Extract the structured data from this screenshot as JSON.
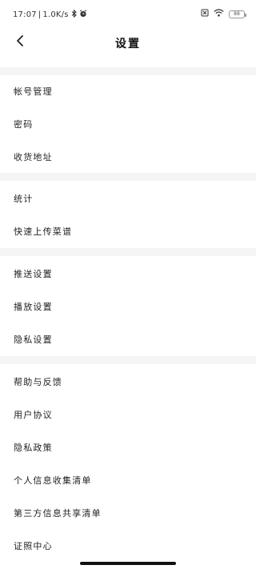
{
  "status_bar": {
    "time": "17:07",
    "speed": "1.0K/s",
    "battery_level": "88",
    "icons": [
      "bluetooth-icon",
      "alarm-icon",
      "sim-icon",
      "wifi-icon",
      "battery-icon"
    ]
  },
  "nav": {
    "title": "设置",
    "back_icon": "chevron-left-icon"
  },
  "groups": [
    {
      "items": [
        {
          "label": "帐号管理"
        },
        {
          "label": "密码"
        },
        {
          "label": "收货地址"
        }
      ]
    },
    {
      "items": [
        {
          "label": "统计"
        },
        {
          "label": "快速上传菜谱"
        }
      ]
    },
    {
      "items": [
        {
          "label": "推送设置"
        },
        {
          "label": "播放设置"
        },
        {
          "label": "隐私设置"
        }
      ]
    },
    {
      "items": [
        {
          "label": "帮助与反馈"
        },
        {
          "label": "用户协议"
        },
        {
          "label": "隐私政策"
        },
        {
          "label": "个人信息收集清单"
        },
        {
          "label": "第三方信息共享清单"
        },
        {
          "label": "证照中心"
        }
      ]
    }
  ],
  "colors": {
    "background": "#ffffff",
    "group_separator": "#f5f5f5",
    "text": "#222222"
  }
}
